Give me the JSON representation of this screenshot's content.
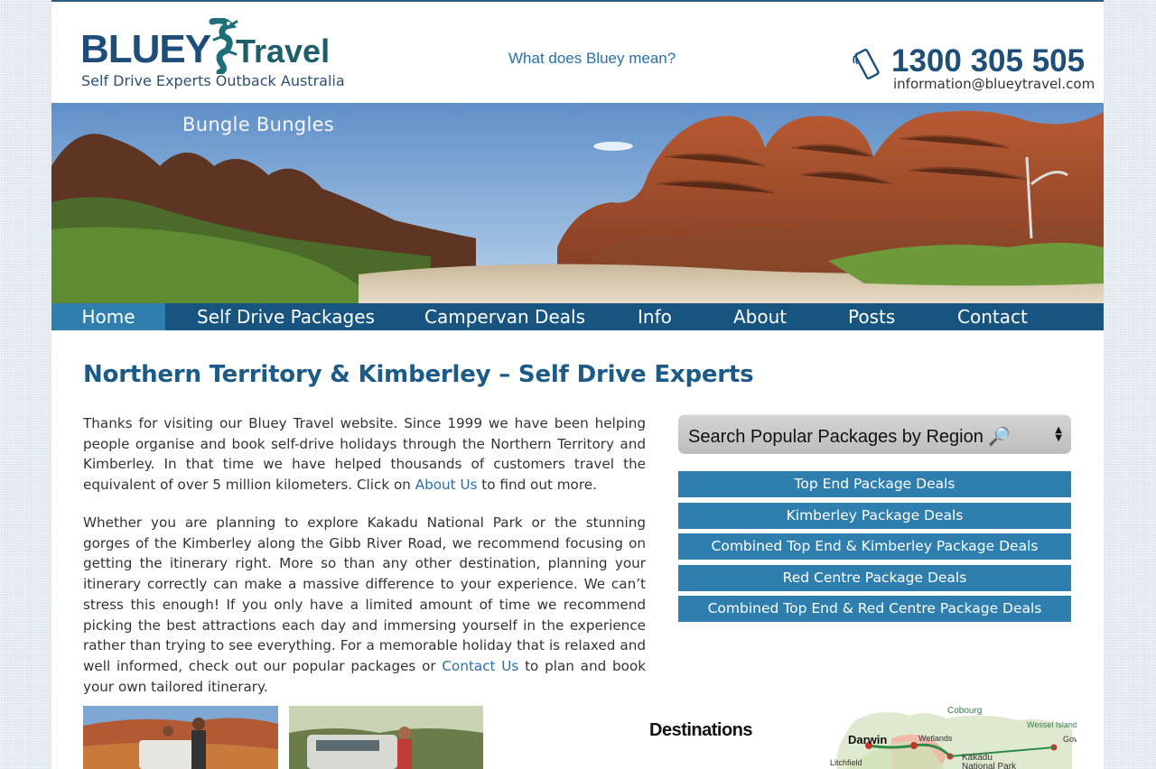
{
  "header": {
    "logo_word": "BLUEY",
    "logo_word2": "Travel",
    "logo_tagline": "Self Drive Experts Outback Australia",
    "bluey_link": "What does Bluey mean?",
    "phone": "1300 305 505",
    "email": "information@blueytravel.com"
  },
  "hero": {
    "caption": "Bungle Bungles"
  },
  "nav": {
    "items": [
      {
        "label": "Home"
      },
      {
        "label": "Self Drive Packages"
      },
      {
        "label": "Campervan Deals"
      },
      {
        "label": "Info"
      },
      {
        "label": "About"
      },
      {
        "label": "Posts"
      },
      {
        "label": "Contact"
      }
    ],
    "active": "Home",
    "bar_color": "#17547f",
    "active_color": "#2e7fae"
  },
  "main": {
    "title": "Northern Territory & Kimberley – Self Drive Experts",
    "p1_text_a": "Thanks for visiting our Bluey Travel website. Since 1999 we have been helping people organise and book self-drive holidays through the Northern Territory and Kimberley. In that time we have helped thousands of customers travel the equivalent of over 5 million kilometers. Click on ",
    "p1_link": "About Us",
    "p1_text_b": " to find out more.",
    "p2_text_a": "Whether you are planning to explore Kakadu National Park or the stunning gorges of the Kimberley along the Gibb River Road, we recommend focusing on getting the itinerary right. More so than any other destination, planning your itinerary correctly can make a massive difference to your experience. We can’t stress this enough! If you only have a limited amount of time we recommend picking the best attractions each day and immersing yourself in the experience rather than trying to see everything. For a memorable holiday that is relaxed and well informed, check out our popular packages or ",
    "p2_link": "Contact Us",
    "p2_text_b": " to plan and book your own tailored itinerary."
  },
  "sidebar": {
    "region_select": "Search Popular Packages by Region 🔎",
    "packages": [
      "Top End Package Deals",
      "Kimberley Package Deals",
      "Combined Top End & Kimberley Package Deals",
      "Red Centre Package Deals",
      "Combined Top End & Red Centre Package Deals"
    ]
  },
  "destinations": {
    "title": "Destinations",
    "map_labels": [
      "Cobourg",
      "Darwin",
      "Wetlands",
      "Wessel Islands",
      "Gove",
      "Kakadu",
      "National Park",
      "Litchfield"
    ]
  }
}
